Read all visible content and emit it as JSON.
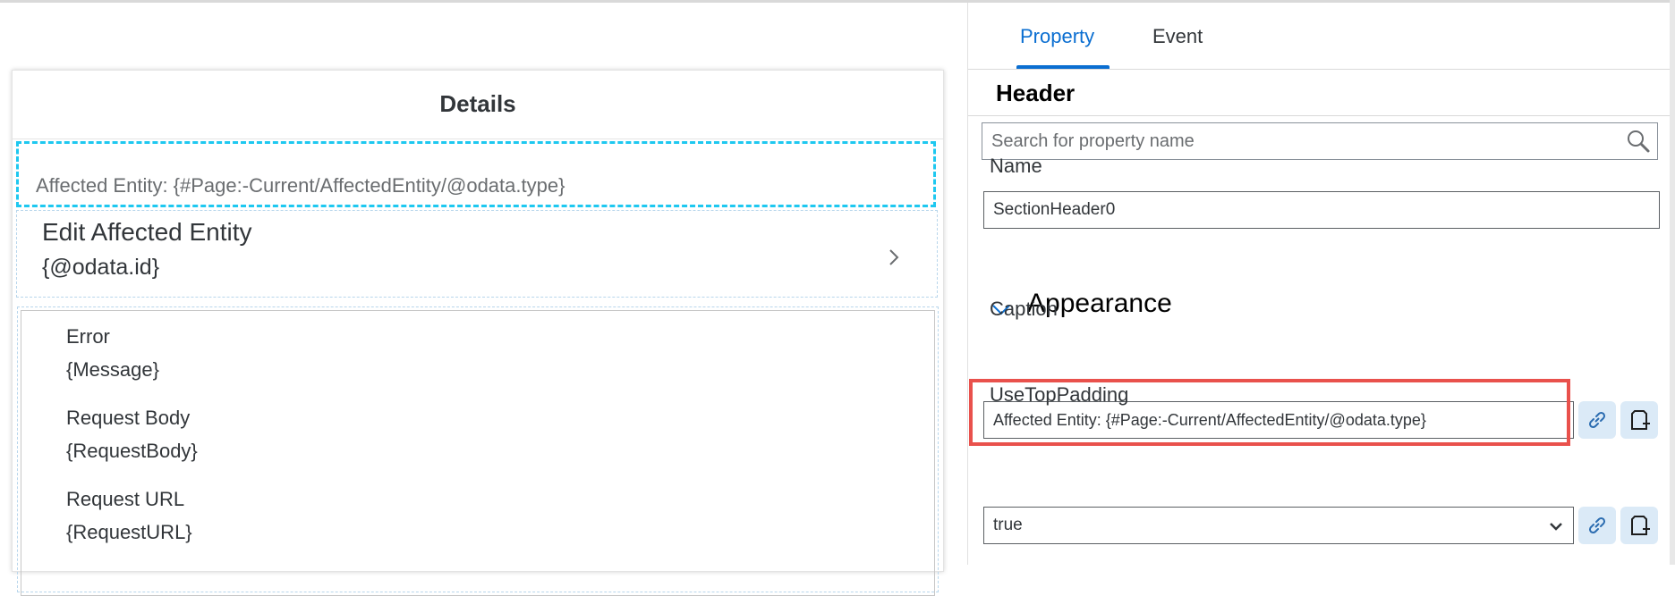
{
  "canvas": {
    "details_title": "Details",
    "header_caption": "Affected Entity: {#Page:-Current/AffectedEntity/@odata.type}",
    "list_item": {
      "title": "Edit Affected Entity",
      "subtitle": "{@odata.id}"
    },
    "key_values": [
      {
        "label": "Error",
        "value": "{Message}"
      },
      {
        "label": "Request Body",
        "value": "{RequestBody}"
      },
      {
        "label": "Request URL",
        "value": "{RequestURL}"
      }
    ]
  },
  "panel": {
    "tabs": [
      {
        "label": "Property",
        "active": true
      },
      {
        "label": "Event",
        "active": false
      }
    ],
    "title": "Header",
    "search": {
      "placeholder": "Search for property name"
    },
    "name": {
      "label": "Name",
      "value": "SectionHeader0"
    },
    "appearance": {
      "title": "Appearance",
      "expanded": true
    },
    "caption": {
      "label": "Caption",
      "value": "Affected Entity: {#Page:-Current/AffectedEntity/@odata.type}"
    },
    "use_top_padding": {
      "label": "UseTopPadding",
      "value": "true"
    }
  },
  "colors": {
    "accent": "#0a6ed1",
    "selection_dashed": "#1ec8f0",
    "highlight_red": "#e9514c",
    "icon_button_bg": "#dbeaf7"
  }
}
